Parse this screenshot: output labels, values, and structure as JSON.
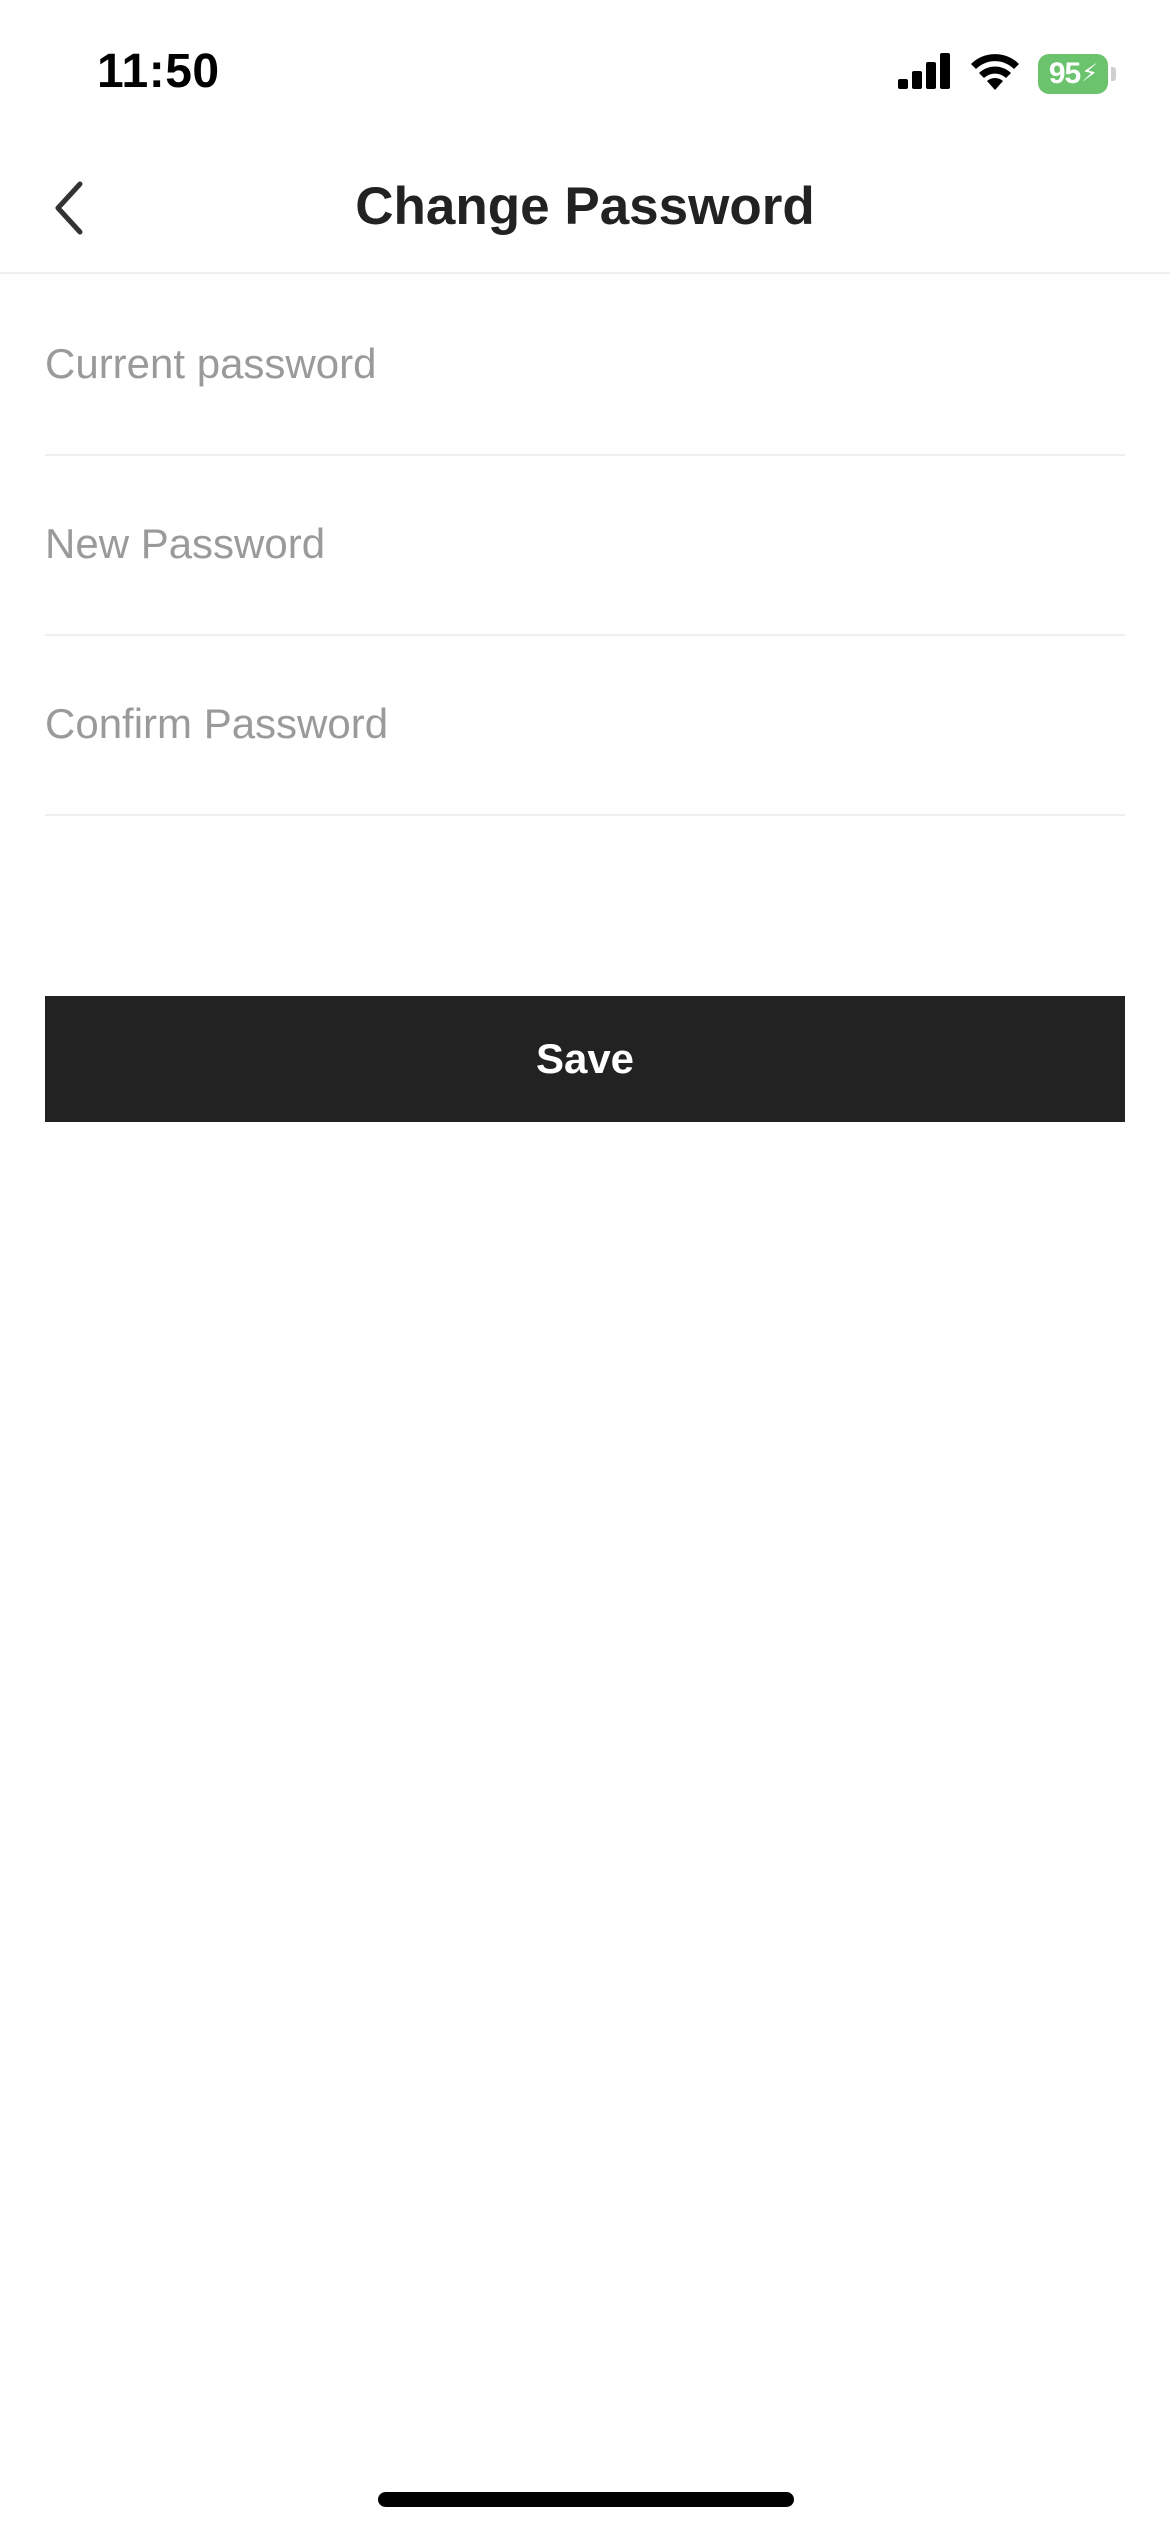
{
  "status_bar": {
    "time": "11:50",
    "battery_level": "95",
    "battery_color": "#6bc46d",
    "signal_icon": "cellular-signal-icon",
    "wifi_icon": "wifi-icon",
    "bolt_glyph": "⚡"
  },
  "nav": {
    "title": "Change Password",
    "back_icon": "chevron-left-icon"
  },
  "form": {
    "current_password": {
      "value": "",
      "placeholder": "Current password"
    },
    "new_password": {
      "value": "",
      "placeholder": "New Password"
    },
    "confirm_password": {
      "value": "",
      "placeholder": "Confirm Password"
    }
  },
  "actions": {
    "save_label": "Save"
  }
}
